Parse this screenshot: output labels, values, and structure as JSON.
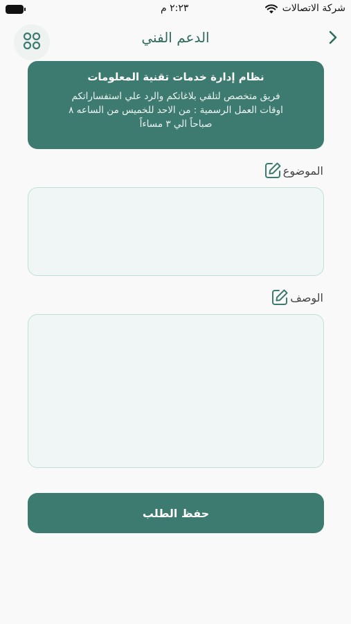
{
  "status_bar": {
    "carrier": "شركة الاتصالات",
    "time": "٢:٢٣ م",
    "icons": [
      "wifi-icon",
      "battery-icon"
    ]
  },
  "nav": {
    "title": "الدعم الفني",
    "back_icon": "chevron-right-icon",
    "menu_icon": "grid-icon"
  },
  "info_card": {
    "title": "نظام إدارة خدمات تقنية المعلومات",
    "lines": [
      "فريق متخصص لتلقي بلاغاتكم والرد علي استفساراتكم",
      "اوقات العمل الرسمية : من الاحد للخميس من الساعه ٨",
      "صباحاً الي ٣ مساءاً"
    ]
  },
  "form": {
    "subject_label": "الموضوع",
    "subject_value": "",
    "description_label": "الوصف",
    "description_value": "",
    "label_icon": "edit-icon"
  },
  "save_button": "حفظ الطلب",
  "colors": {
    "primary": "#3d7a6f",
    "title": "#2f6b5f",
    "field_border": "#bfe0d8",
    "field_bg": "#f0f6f5",
    "background": "#f8f9f8"
  }
}
